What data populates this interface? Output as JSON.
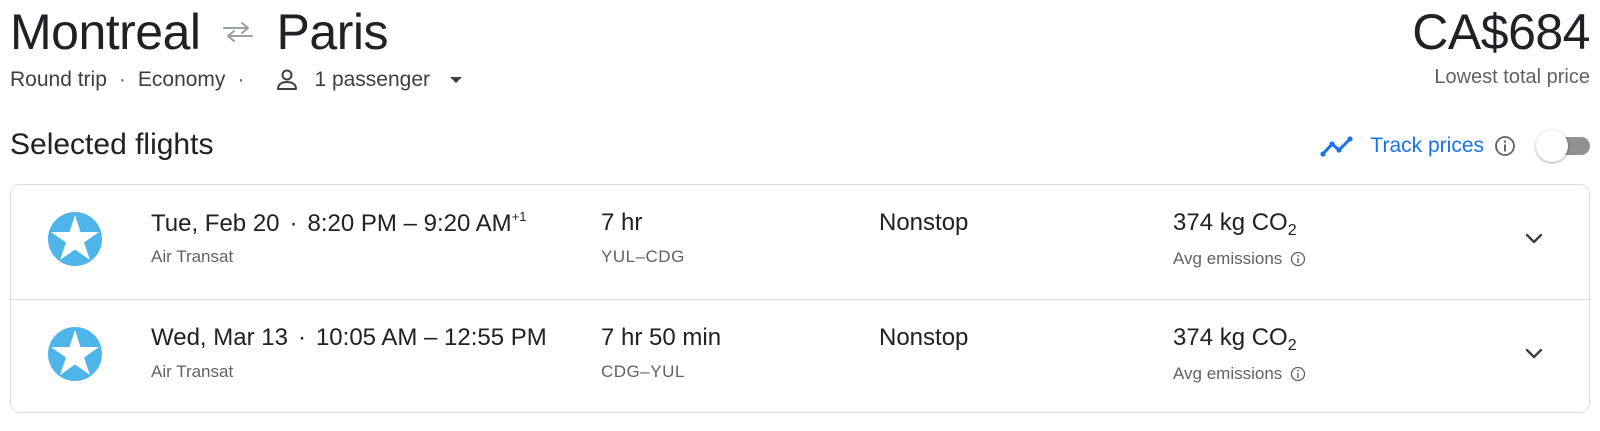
{
  "header": {
    "origin": "Montreal",
    "destination": "Paris",
    "swap_icon": "swap-arrows-icon",
    "trip_type": "Round trip",
    "cabin": "Economy",
    "passengers": "1 passenger",
    "price": "CA$684",
    "price_label": "Lowest total price"
  },
  "section": {
    "title": "Selected flights",
    "track_label": "Track prices",
    "track_toggle_on": false
  },
  "flights": [
    {
      "date": "Tue, Feb 20",
      "depart": "8:20 PM",
      "arrive": "9:20 AM",
      "day_offset": "+1",
      "airline": "Air Transat",
      "duration": "7 hr",
      "route": "YUL–CDG",
      "stops": "Nonstop",
      "emissions_value": "374 kg CO",
      "emissions_sub": "2",
      "emissions_label": "Avg emissions"
    },
    {
      "date": "Wed, Mar 13",
      "depart": "10:05 AM",
      "arrive": "12:55 PM",
      "day_offset": "",
      "airline": "Air Transat",
      "duration": "7 hr 50 min",
      "route": "CDG–YUL",
      "stops": "Nonstop",
      "emissions_value": "374 kg CO",
      "emissions_sub": "2",
      "emissions_label": "Avg emissions"
    }
  ],
  "colors": {
    "accent": "#1a73e8",
    "logo_blue": "#4fb4ea",
    "text": "#202124",
    "muted": "#5f6368",
    "border": "#dadce0"
  }
}
